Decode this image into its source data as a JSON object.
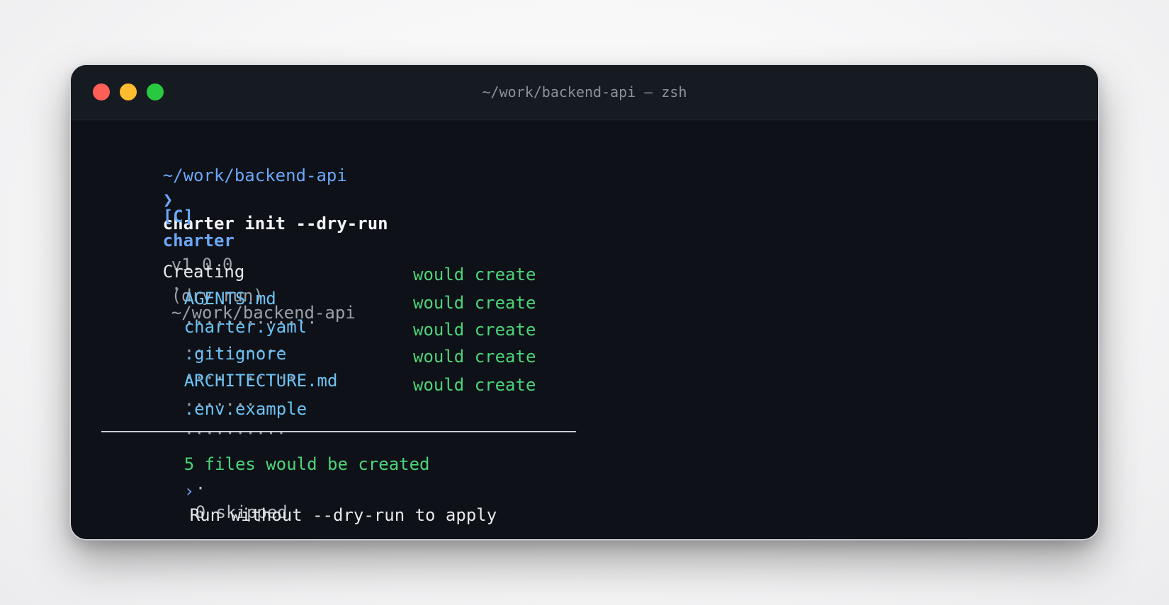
{
  "window": {
    "title": "~/work/backend-api — zsh",
    "colors": {
      "close": "#fe5f57",
      "minimize": "#febc2e",
      "maximize": "#28c840",
      "background": "#0e1117"
    }
  },
  "prompt": {
    "cwd": "~/work/backend-api",
    "arrow": "❯",
    "command": "charter init --dry-run"
  },
  "banner": {
    "tag": "[C]",
    "name": "charter",
    "version": "v1.0.0",
    "separator": "·",
    "path": "~/work/backend-api"
  },
  "section": {
    "heading": "Creating",
    "mode": "(dry run)"
  },
  "files": [
    {
      "name": "AGENTS.md",
      "dots": "·············",
      "status": "would create"
    },
    {
      "name": "charter.yaml",
      "dots": "··········",
      "status": "would create"
    },
    {
      "name": ".gitignore",
      "dots": "···········",
      "status": "would create"
    },
    {
      "name": "ARCHITECTURE.md",
      "dots": "·······",
      "status": "would create"
    },
    {
      "name": ".env.example",
      "dots": "··········",
      "status": "would create"
    }
  ],
  "summary": {
    "created": "5 files would be created",
    "separator": "·",
    "skipped": "0 skipped"
  },
  "hint": {
    "arrow": "›",
    "text": "Run without --dry-run to apply"
  }
}
